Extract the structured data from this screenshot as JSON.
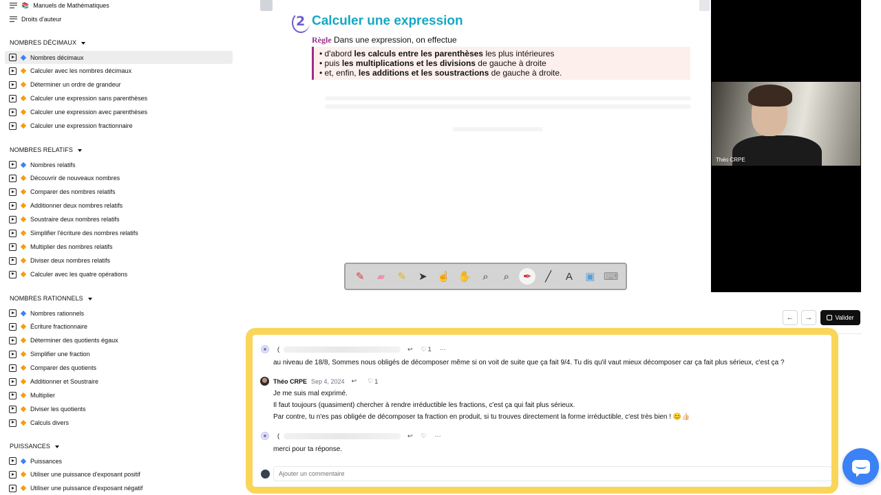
{
  "sidebar": {
    "top_links": [
      "Manuels de Mathématiques",
      "Droits d'auteur"
    ],
    "manuels_emoji": "📚",
    "sections": [
      {
        "title": "NOMBRES DÉCIMAUX",
        "items": [
          {
            "label": "Nombres décimaux",
            "marker": "blue"
          },
          {
            "label": "Calculer avec les nombres décimaux",
            "marker": "orange"
          },
          {
            "label": "Déterminer un ordre de grandeur",
            "marker": "orange"
          },
          {
            "label": "Calculer une expression sans parenthèses",
            "marker": "orange"
          },
          {
            "label": "Calculer une expression avec parenthèses",
            "marker": "orange"
          },
          {
            "label": "Calculer une expression fractionnaire",
            "marker": "orange"
          }
        ]
      },
      {
        "title": "NOMBRES RELATIFS",
        "items": [
          {
            "label": "Nombres relatifs",
            "marker": "blue"
          },
          {
            "label": "Découvrir de nouveaux nombres",
            "marker": "orange"
          },
          {
            "label": "Comparer des nombres relatifs",
            "marker": "orange"
          },
          {
            "label": "Additionner deux nombres relatifs",
            "marker": "orange"
          },
          {
            "label": "Soustraire deux nombres relatifs",
            "marker": "orange"
          },
          {
            "label": "Simplifier l'écriture des nombres relatifs",
            "marker": "orange"
          },
          {
            "label": "Multiplier des nombres relatifs",
            "marker": "orange"
          },
          {
            "label": "Diviser deux nombres relatifs",
            "marker": "orange"
          },
          {
            "label": "Calculer avec les quatre opérations",
            "marker": "orange"
          }
        ]
      },
      {
        "title": "NOMBRES RATIONNELS",
        "items": [
          {
            "label": "Nombres rationnels",
            "marker": "blue"
          },
          {
            "label": "Écriture fractionnaire",
            "marker": "orange"
          },
          {
            "label": "Déterminer des quotients égaux",
            "marker": "orange"
          },
          {
            "label": "Simplifier une fraction",
            "marker": "orange"
          },
          {
            "label": "Comparer des quotients",
            "marker": "orange"
          },
          {
            "label": "Additionner et Soustraire",
            "marker": "orange"
          },
          {
            "label": "Multiplier",
            "marker": "orange"
          },
          {
            "label": "Diviser les quotients",
            "marker": "orange"
          },
          {
            "label": "Calculs divers",
            "marker": "orange"
          }
        ]
      },
      {
        "title": "PUISSANCES",
        "items": [
          {
            "label": "Puissances",
            "marker": "blue"
          },
          {
            "label": "Utiliser une puissance d'exposant positif",
            "marker": "orange"
          },
          {
            "label": "Utiliser une puissance d'exposant négatif",
            "marker": "orange"
          }
        ]
      }
    ]
  },
  "slide": {
    "section_number": "2",
    "title": "Calculer une expression",
    "rule_word": "Règle",
    "rule_intro": "Dans une expression, on effectue",
    "rules": [
      {
        "prefix": "d'abord ",
        "bold": "les calculs entre les parenthèses",
        "suffix": " les plus intérieures"
      },
      {
        "prefix": "puis ",
        "bold": "les multiplications et les divisions",
        "suffix": " de gauche à droite"
      },
      {
        "prefix": "et, enfin, ",
        "bold": "les additions et les soustractions",
        "suffix": " de gauche à droite."
      }
    ]
  },
  "webcam": {
    "name": "Théo CRPE"
  },
  "toolbar": {
    "tools": [
      {
        "icon": "marker-red-icon",
        "glyph": "✎",
        "color": "#d83a3a"
      },
      {
        "icon": "eraser-icon",
        "glyph": "▰",
        "color": "#f08fb0"
      },
      {
        "icon": "highlighter-icon",
        "glyph": "✎",
        "color": "#e3b21a"
      },
      {
        "icon": "pointer-icon",
        "glyph": "➤",
        "color": "#333333"
      },
      {
        "icon": "hand-point-icon",
        "glyph": "☝",
        "color": "#e9a86a"
      },
      {
        "icon": "hand-pan-icon",
        "glyph": "✋",
        "color": "#e9a86a"
      },
      {
        "icon": "zoom-in-icon",
        "glyph": "⌕",
        "color": "#333333"
      },
      {
        "icon": "zoom-out-icon",
        "glyph": "⌕",
        "color": "#333333"
      },
      {
        "icon": "pen-icon",
        "glyph": "✒",
        "color": "#cc3333",
        "selected": true
      },
      {
        "icon": "line-icon",
        "glyph": "╱",
        "color": "#333333"
      },
      {
        "icon": "text-icon",
        "glyph": "A",
        "color": "#333333"
      },
      {
        "icon": "screen-icon",
        "glyph": "▣",
        "color": "#5aa0d8"
      },
      {
        "icon": "keyboard-icon",
        "glyph": "⌨",
        "color": "#888888"
      }
    ]
  },
  "nav": {
    "prev": "←",
    "next": "→",
    "valider": "Valider"
  },
  "comments": {
    "c1": {
      "initial": "(",
      "likes": "1",
      "text": "au niveau de 18/8, Sommes nous obligés de décomposer même si on voit de suite que ça fait 9/4. Tu dis qu'il vaut mieux décomposer car ça fait plus sérieux, c'est ça ?"
    },
    "reply": {
      "author": "Théo CRPE",
      "date": "Sep 4, 2024",
      "likes": "1",
      "lines": [
        "Je me suis mal exprimé.",
        "Il faut toujours (quasiment) chercher à rendre irréductible les fractions, c'est ça qui fait plus sérieux.",
        "Par contre, tu n'es pas obligée de décomposer ta fraction en produit, si tu trouves directement la forme irréductible, c'est très bien ! 😊👍🏻"
      ]
    },
    "c2": {
      "initial": "(",
      "text": "merci pour ta réponse."
    },
    "input_placeholder": "Ajouter un commentaire",
    "more": "···"
  }
}
